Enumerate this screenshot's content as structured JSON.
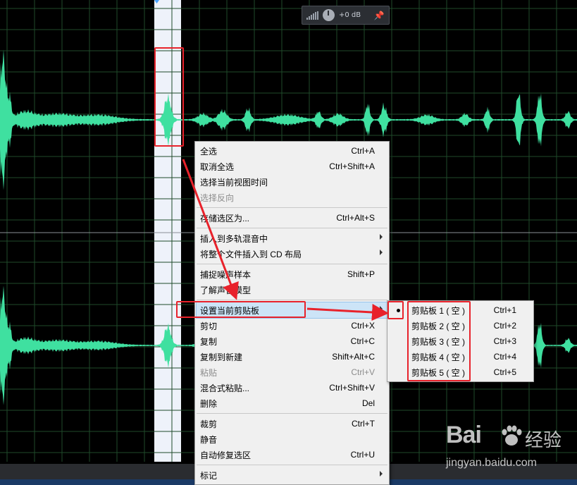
{
  "hud": {
    "gain_label": "+0 dB"
  },
  "context_menu": {
    "groups": [
      [
        {
          "label": "全选",
          "shortcut": "Ctrl+A"
        },
        {
          "label": "取消全选",
          "shortcut": "Ctrl+Shift+A"
        },
        {
          "label": "选择当前视图时间",
          "shortcut": ""
        },
        {
          "label": "选择反向",
          "shortcut": "",
          "disabled": true
        }
      ],
      [
        {
          "label": "存储选区为...",
          "shortcut": "Ctrl+Alt+S"
        }
      ],
      [
        {
          "label": "插入到多轨混音中",
          "shortcut": "",
          "submenu": true
        },
        {
          "label": "将整个文件插入到 CD 布局",
          "shortcut": "",
          "submenu": true
        }
      ],
      [
        {
          "label": "捕捉噪声样本",
          "shortcut": "Shift+P"
        },
        {
          "label": "了解声音模型",
          "shortcut": ""
        }
      ],
      [
        {
          "label": "设置当前剪贴板",
          "shortcut": "",
          "submenu": true,
          "highlight": true
        },
        {
          "label": "剪切",
          "shortcut": "Ctrl+X"
        },
        {
          "label": "复制",
          "shortcut": "Ctrl+C"
        },
        {
          "label": "复制到新建",
          "shortcut": "Shift+Alt+C"
        },
        {
          "label": "粘贴",
          "shortcut": "Ctrl+V",
          "disabled": true
        },
        {
          "label": "混合式粘贴...",
          "shortcut": "Ctrl+Shift+V"
        },
        {
          "label": "删除",
          "shortcut": "Del"
        }
      ],
      [
        {
          "label": "裁剪",
          "shortcut": "Ctrl+T"
        },
        {
          "label": "静音",
          "shortcut": ""
        },
        {
          "label": "自动修复选区",
          "shortcut": "Ctrl+U"
        }
      ],
      [
        {
          "label": "标记",
          "shortcut": "",
          "submenu": true
        }
      ]
    ]
  },
  "clipboard_submenu": {
    "items": [
      {
        "label": "剪贴板 1 ( 空 )",
        "shortcut": "Ctrl+1",
        "selected": true
      },
      {
        "label": "剪贴板 2 ( 空 )",
        "shortcut": "Ctrl+2"
      },
      {
        "label": "剪贴板 3 ( 空 )",
        "shortcut": "Ctrl+3"
      },
      {
        "label": "剪贴板 4 ( 空 )",
        "shortcut": "Ctrl+4"
      },
      {
        "label": "剪贴板 5 ( 空 )",
        "shortcut": "Ctrl+5"
      }
    ]
  },
  "watermark": {
    "brand": "Bai",
    "brand2": "经验",
    "url": "jingyan.baidu.com"
  },
  "colors": {
    "background": "#000000",
    "grid": "#1f4a2a",
    "waveform": "#3fe0a0",
    "selection": "#eef2fa",
    "selection_wave": "#1f3a2c",
    "menu_bg": "#f0f0f0",
    "menu_highlight": "#cce4f7",
    "annotation": "#e8222b"
  }
}
